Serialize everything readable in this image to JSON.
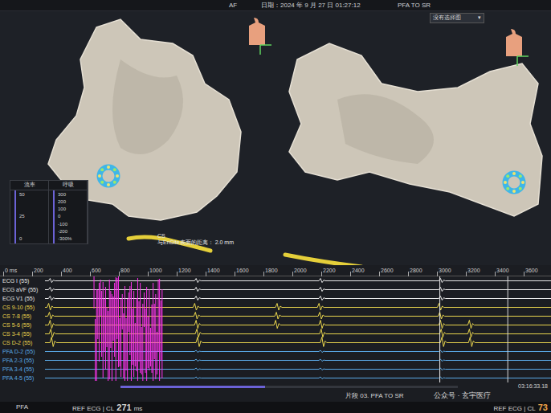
{
  "header": {
    "rhythm": "AF",
    "date": "日期：2024 年 9 月 27 日 01:27:12",
    "title": "PFA TO SR",
    "map_select": "没有选择图",
    "map_select_arrow": "▾"
  },
  "panels": [
    {
      "title": "流率",
      "ticks": [
        "50",
        "25",
        "0"
      ]
    },
    {
      "title": "呼吸",
      "ticks": [
        "300",
        "200",
        "100",
        "0",
        "-100",
        "-200",
        "-300%"
      ]
    }
  ],
  "catheter": {
    "label": "CS",
    "distance": "与EnSite表面的距离：",
    "value": "2.0 mm"
  },
  "timeline": {
    "ticks": [
      {
        "label": "0 ms",
        "ms": 0
      },
      {
        "label": "200",
        "ms": 200
      },
      {
        "label": "400",
        "ms": 400
      },
      {
        "label": "600",
        "ms": 600
      },
      {
        "label": "800",
        "ms": 800
      },
      {
        "label": "1000",
        "ms": 1000
      },
      {
        "label": "1200",
        "ms": 1200
      },
      {
        "label": "1400",
        "ms": 1400
      },
      {
        "label": "1600",
        "ms": 1600
      },
      {
        "label": "1800",
        "ms": 1800
      },
      {
        "label": "2000",
        "ms": 2000
      },
      {
        "label": "2200",
        "ms": 2200
      },
      {
        "label": "2400",
        "ms": 2400
      },
      {
        "label": "2600",
        "ms": 2600
      },
      {
        "label": "2800",
        "ms": 2800
      },
      {
        "label": "3000",
        "ms": 3000
      },
      {
        "label": "3200",
        "ms": 3200
      },
      {
        "label": "3400",
        "ms": 3400
      },
      {
        "label": "3600",
        "ms": 3600
      }
    ],
    "cursors": [
      3020,
      3490
    ]
  },
  "ablation": {
    "start": 628,
    "end": 1105,
    "color": "#ff33ee"
  },
  "channels": [
    {
      "name": "ECG I (55)",
      "color": "#e8e8e8",
      "amplitude": 3,
      "beats": [
        330,
        1340,
        2200,
        3030
      ]
    },
    {
      "name": "ECG aVF (55)",
      "color": "#e8e8e8",
      "amplitude": 3,
      "beats": [
        330,
        1340,
        2200,
        3030
      ]
    },
    {
      "name": "ECG V1 (55)",
      "color": "#e8e8e8",
      "amplitude": 3,
      "beats": [
        330,
        1340,
        2200,
        3030
      ]
    },
    {
      "name": "CS 9-10 (55)",
      "color": "#e8d44d",
      "amplitude": 5,
      "beats": [
        320,
        1330,
        1900,
        2190,
        3020
      ]
    },
    {
      "name": "CS 7-8 (55)",
      "color": "#e8d44d",
      "amplitude": 5,
      "beats": [
        325,
        1335,
        1895,
        2195,
        3025
      ]
    },
    {
      "name": "CS 5-6 (55)",
      "color": "#e8d44d",
      "amplitude": 6,
      "beats": [
        330,
        1340,
        1890,
        2200,
        3030,
        3230
      ]
    },
    {
      "name": "CS 3-4 (55)",
      "color": "#e8d44d",
      "amplitude": 6,
      "beats": [
        335,
        1345,
        2205,
        3035,
        3230
      ]
    },
    {
      "name": "CS D-2 (55)",
      "color": "#e8d44d",
      "amplitude": 7,
      "beats": [
        340,
        1350,
        2210,
        3040,
        3235
      ]
    },
    {
      "name": "PFA D-2 (55)",
      "color": "#5aa9e6",
      "amplitude": 1.5,
      "beats": [
        1340,
        2200,
        3030
      ]
    },
    {
      "name": "PFA 2-3 (55)",
      "color": "#5aa9e6",
      "amplitude": 1.5,
      "beats": [
        1340,
        2200,
        3030
      ]
    },
    {
      "name": "PFA 3-4 (55)",
      "color": "#5aa9e6",
      "amplitude": 1.5,
      "beats": [
        1340,
        2200,
        3030
      ]
    },
    {
      "name": "PFA 4-5 (55)",
      "color": "#5aa9e6",
      "amplitude": 1.5,
      "beats": [
        1340,
        2200,
        3030
      ]
    }
  ],
  "timestamp": "03:16:33.18",
  "segment": "片段 03. PFA TO SR",
  "watermark": "公众号 · 玄宇医疗",
  "footer": {
    "tab": "PFA",
    "left_label": "REF ECG | CL",
    "left_value": "271",
    "left_unit": "ms",
    "right_label": "REF ECG | CL",
    "right_value": "73"
  }
}
